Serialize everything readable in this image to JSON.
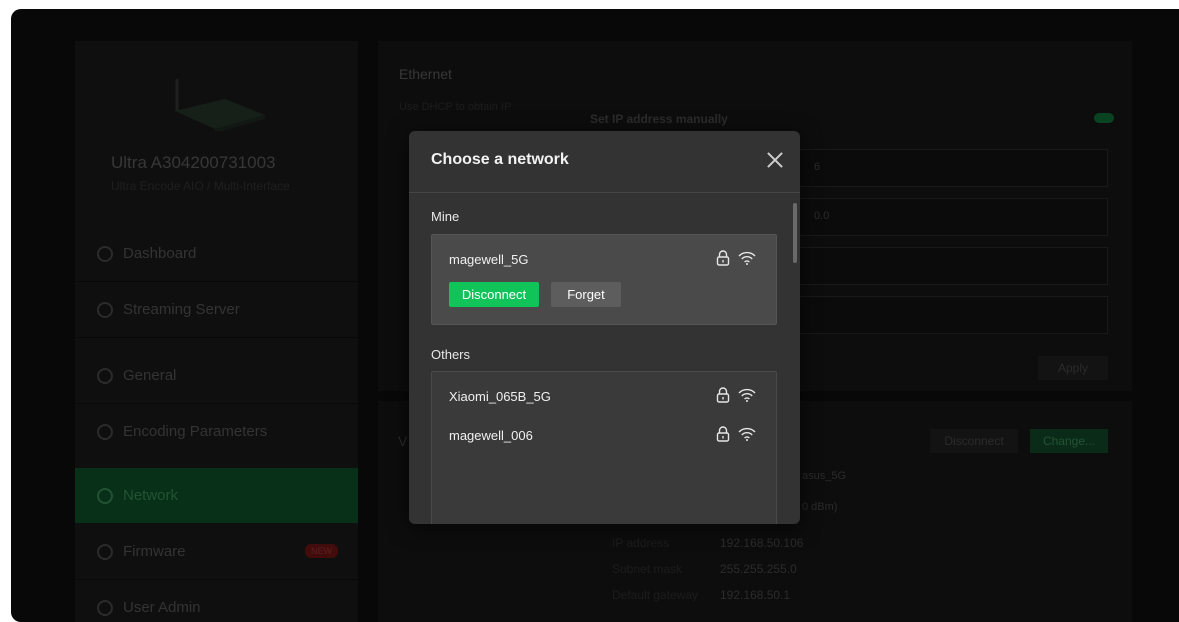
{
  "sidebar": {
    "device_name": "Ultra A304200731003",
    "device_sub": "Ultra Encode AIO / Multi-Interface",
    "items": [
      {
        "label": "Dashboard",
        "icon": "dashboard-icon"
      },
      {
        "label": "Streaming Server",
        "icon": "server-icon"
      },
      {
        "label": "General",
        "icon": "gear-icon"
      },
      {
        "label": "Encoding Parameters",
        "icon": "encoding-icon"
      },
      {
        "label": "Network",
        "icon": "network-icon",
        "selected": true
      },
      {
        "label": "Firmware",
        "icon": "firmware-icon",
        "badge": "NEW"
      },
      {
        "label": "User Admin",
        "icon": "user-icon"
      }
    ]
  },
  "main": {
    "ethernet_title": "Ethernet",
    "ethernet_sub": "Use DHCP to obtain IP",
    "manual_ip_label": "Set IP address manually",
    "field1_tail": "6",
    "field2_tail": "0.0",
    "apply_label": "Apply",
    "wifi_disconnect": "Disconnect",
    "wifi_change": "Change...",
    "ssid_tail": "asus_5G",
    "signal_tail": "0 dBm)",
    "rows": [
      {
        "label": "IP address",
        "value": "192.168.50.106"
      },
      {
        "label": "Subnet mask",
        "value": "255.255.255.0"
      },
      {
        "label": "Default gateway",
        "value": "192.168.50.1"
      }
    ]
  },
  "modal": {
    "title": "Choose a network",
    "mine_label": "Mine",
    "others_label": "Others",
    "mine": {
      "name": "magewell_5G",
      "disconnect": "Disconnect",
      "forget": "Forget"
    },
    "others": [
      {
        "name": "Xiaomi_065B_5G"
      },
      {
        "name": "magewell_006"
      }
    ]
  },
  "colors": {
    "accent": "#10c45a",
    "modal_bg": "#333333"
  }
}
